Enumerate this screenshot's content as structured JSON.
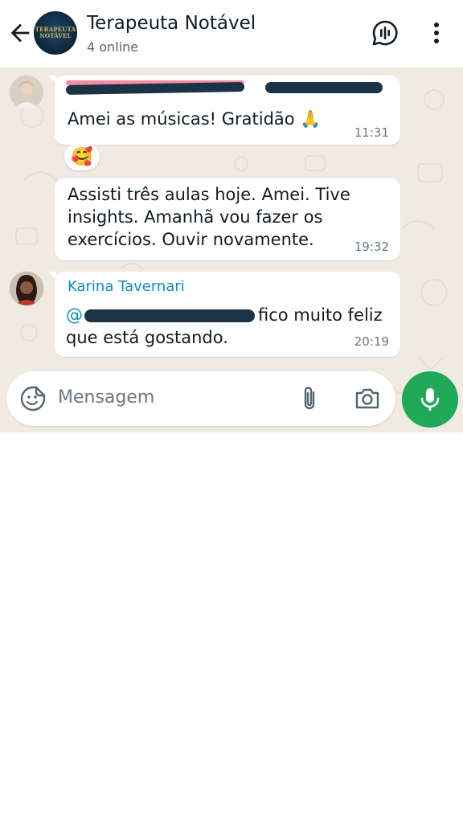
{
  "header": {
    "title": "Terapeuta Notável",
    "subtitle": "4 online",
    "avatar_text_line1": "TERAPEUTA",
    "avatar_text_line2": "NOTÁVEL",
    "icons": [
      "back-arrow-icon",
      "voice-chat-icon",
      "more-vert-icon"
    ]
  },
  "messages": [
    {
      "sender": "",
      "text": "Amei as músicas! Gratidão 🙏",
      "time": "11:31"
    },
    {
      "sender": "",
      "text": "Assisti três aulas hoje. Amei. Tive insights. Amanhã vou fazer os exercícios. Ouvir novamente.",
      "time": "19:32"
    },
    {
      "sender": "Karina Tavernari",
      "mention_prefix": "@",
      "text": "fico muito feliz que está gostando.",
      "time": "20:19"
    }
  ],
  "reaction": {
    "emoji": "🥰"
  },
  "composer": {
    "placeholder": "Mensagem",
    "icons": [
      "sticker-icon",
      "paperclip-icon",
      "camera-icon",
      "microphone-icon"
    ]
  },
  "colors": {
    "chat_background": "#efeae2",
    "bubble": "#ffffff",
    "sender_name": "#0a8fb8",
    "mic_button": "#21a95a",
    "timestamp": "#667781"
  }
}
